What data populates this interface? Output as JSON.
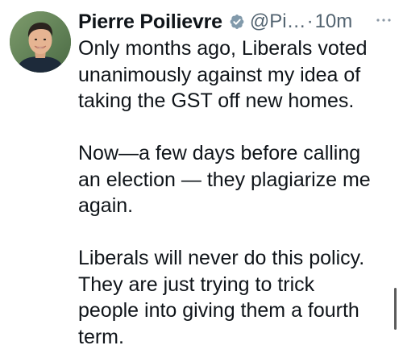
{
  "tweet": {
    "author": {
      "display_name": "Pierre Poilievre",
      "handle": "@Pi…",
      "verified": true,
      "avatar": "profile-photo"
    },
    "separator": "·",
    "time": "10m",
    "more_icon": "more-horizontal-icon",
    "paragraphs": [
      {
        "lines": [
          "Only months ago, Liberals voted",
          "unanimously against my idea of",
          "taking the GST off new homes."
        ]
      },
      {
        "lines": [
          "Now—a few days before calling",
          "an election — they plagiarize me",
          "again."
        ]
      },
      {
        "lines": [
          "Liberals will never do this policy.",
          "They are just trying to trick",
          "people into giving them a fourth",
          "term."
        ]
      }
    ]
  },
  "colors": {
    "text_primary": "#0f1419",
    "text_secondary": "#536471",
    "verified_badge": "#829aab",
    "background": "#ffffff"
  }
}
